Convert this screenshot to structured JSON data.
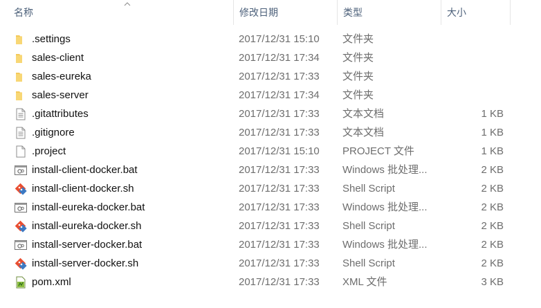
{
  "columns": {
    "name": "名称",
    "date": "修改日期",
    "type": "类型",
    "size": "大小"
  },
  "files": [
    {
      "name": ".settings",
      "date": "2017/12/31 15:10",
      "type": "文件夹",
      "size": "",
      "icon": "folder-icon"
    },
    {
      "name": "sales-client",
      "date": "2017/12/31 17:34",
      "type": "文件夹",
      "size": "",
      "icon": "folder-icon"
    },
    {
      "name": "sales-eureka",
      "date": "2017/12/31 17:33",
      "type": "文件夹",
      "size": "",
      "icon": "folder-icon"
    },
    {
      "name": "sales-server",
      "date": "2017/12/31 17:34",
      "type": "文件夹",
      "size": "",
      "icon": "folder-icon"
    },
    {
      "name": ".gitattributes",
      "date": "2017/12/31 17:33",
      "type": "文本文档",
      "size": "1 KB",
      "icon": "text-file-icon"
    },
    {
      "name": ".gitignore",
      "date": "2017/12/31 17:33",
      "type": "文本文档",
      "size": "1 KB",
      "icon": "text-file-icon"
    },
    {
      "name": ".project",
      "date": "2017/12/31 15:10",
      "type": "PROJECT 文件",
      "size": "1 KB",
      "icon": "blank-file-icon"
    },
    {
      "name": "install-client-docker.bat",
      "date": "2017/12/31 17:33",
      "type": "Windows 批处理...",
      "size": "2 KB",
      "icon": "batch-file-icon"
    },
    {
      "name": "install-client-docker.sh",
      "date": "2017/12/31 17:33",
      "type": "Shell Script",
      "size": "2 KB",
      "icon": "git-script-icon"
    },
    {
      "name": "install-eureka-docker.bat",
      "date": "2017/12/31 17:33",
      "type": "Windows 批处理...",
      "size": "2 KB",
      "icon": "batch-file-icon"
    },
    {
      "name": "install-eureka-docker.sh",
      "date": "2017/12/31 17:33",
      "type": "Shell Script",
      "size": "2 KB",
      "icon": "git-script-icon"
    },
    {
      "name": "install-server-docker.bat",
      "date": "2017/12/31 17:33",
      "type": "Windows 批处理...",
      "size": "2 KB",
      "icon": "batch-file-icon"
    },
    {
      "name": "install-server-docker.sh",
      "date": "2017/12/31 17:33",
      "type": "Shell Script",
      "size": "2 KB",
      "icon": "git-script-icon"
    },
    {
      "name": "pom.xml",
      "date": "2017/12/31 17:33",
      "type": "XML 文件",
      "size": "3 KB",
      "icon": "xml-file-icon"
    }
  ],
  "colors": {
    "folder": "#f4c95a",
    "header_text": "#4c607a",
    "git_red": "#e94f32",
    "git_blue": "#3c79c2"
  }
}
